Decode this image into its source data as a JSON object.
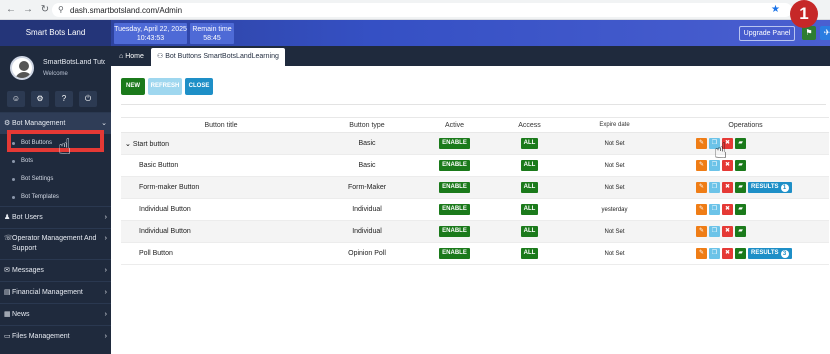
{
  "browser": {
    "url": "dash.smartbotsland.com/Admin",
    "step_number": "1"
  },
  "header": {
    "brand": "Smart Bots Land",
    "date_line1": "Tuesday, April 22, 2025",
    "date_line2": "10:43:53",
    "remain_line1": "Remain time",
    "remain_line2": "58:45",
    "upgrade_label": "Upgrade Panel"
  },
  "profile": {
    "name": "SmartBotsLand Tuto",
    "welcome": "Welcome"
  },
  "sidebar": {
    "items": [
      {
        "label": "Bot Management",
        "icon": "gear-icon"
      },
      {
        "label": "Bot Users",
        "icon": "user-icon"
      },
      {
        "label": "Operator Management And Support",
        "icon": "headset-icon"
      },
      {
        "label": "Messages",
        "icon": "message-icon"
      },
      {
        "label": "Financial Management",
        "icon": "wallet-icon"
      },
      {
        "label": "News",
        "icon": "news-icon"
      },
      {
        "label": "Files Management",
        "icon": "folder-icon"
      }
    ],
    "subitems": [
      "Bot Buttons",
      "Bots",
      "Bot Settings",
      "Bot Templates"
    ]
  },
  "tabs": {
    "home": "Home",
    "current": "Bot Buttons SmartBotsLandLearning"
  },
  "toolbar": {
    "new_label": "NEW",
    "refresh_label": "REFRESH",
    "close_label": "CLOSE"
  },
  "table": {
    "headers": [
      "Button title",
      "Button type",
      "Active",
      "Access",
      "Expire date",
      "Operations"
    ],
    "rows": [
      {
        "title": "Start button",
        "type": "Basic",
        "active": "ENABLE",
        "access": "ALL",
        "expire": "Not Set",
        "results": null,
        "expanded": true
      },
      {
        "title": "Basic Button",
        "type": "Basic",
        "active": "ENABLE",
        "access": "ALL",
        "expire": "Not Set",
        "results": null
      },
      {
        "title": "Form-maker Button",
        "type": "Form-Maker",
        "active": "ENABLE",
        "access": "ALL",
        "expire": "Not Set",
        "results": "RESULTS",
        "results_count": "1"
      },
      {
        "title": "Individual Button",
        "type": "Individual",
        "active": "ENABLE",
        "access": "ALL",
        "expire": "yesterday",
        "results": null
      },
      {
        "title": "Individual Button",
        "type": "Individual",
        "active": "ENABLE",
        "access": "ALL",
        "expire": "Not Set",
        "results": null
      },
      {
        "title": "Poll Button",
        "type": "Opinion Poll",
        "active": "ENABLE",
        "access": "ALL",
        "expire": "Not Set",
        "results": "RESULTS",
        "results_count": "3"
      }
    ]
  },
  "colors": {
    "accent": "#3550c4",
    "sidebar": "#1f2a3d",
    "enable": "#1b7a1b",
    "highlight": "#e53935"
  }
}
